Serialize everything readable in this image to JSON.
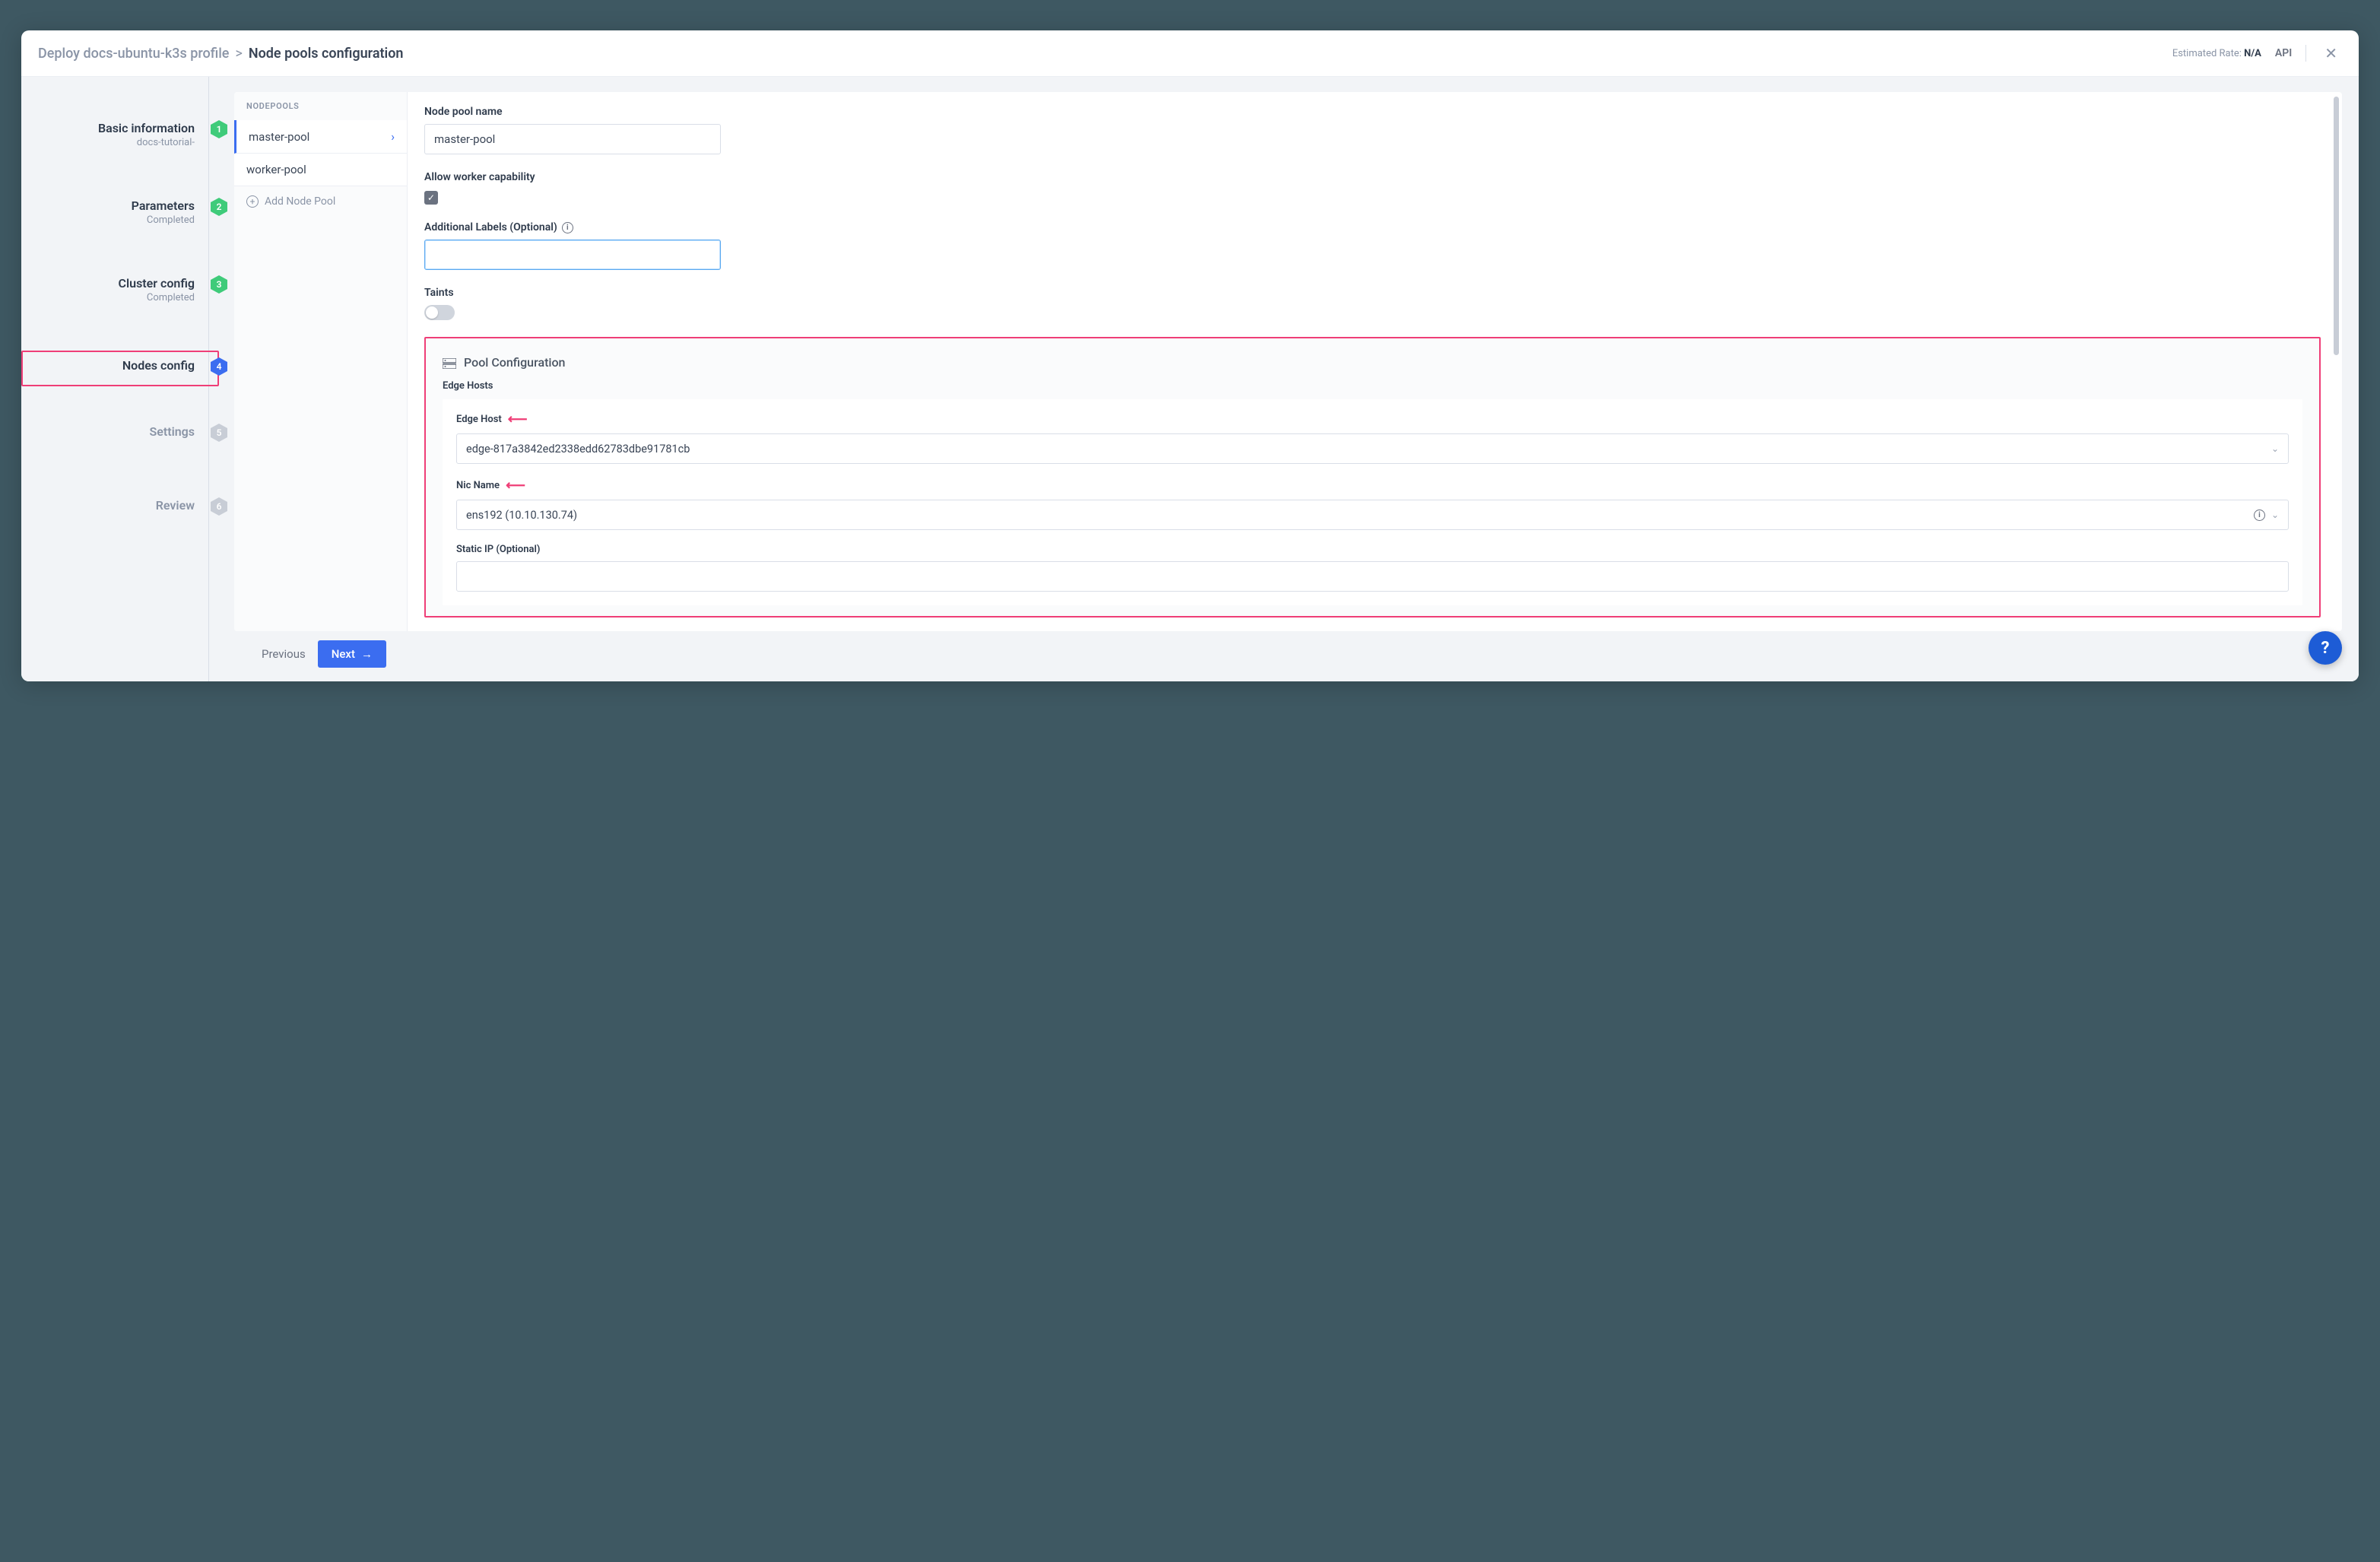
{
  "header": {
    "breadcrumb_prefix": "Deploy docs-ubuntu-k3s profile",
    "breadcrumb_sep": ">",
    "breadcrumb_current": "Node pools configuration",
    "estimated_rate_label": "Estimated Rate:",
    "estimated_rate_value": "N/A",
    "api_label": "API"
  },
  "steps": [
    {
      "title": "Basic information",
      "sub": "docs-tutorial-",
      "num": "1",
      "state": "done"
    },
    {
      "title": "Parameters",
      "sub": "Completed",
      "num": "2",
      "state": "done"
    },
    {
      "title": "Cluster config",
      "sub": "Completed",
      "num": "3",
      "state": "done"
    },
    {
      "title": "Nodes config",
      "sub": "",
      "num": "4",
      "state": "current"
    },
    {
      "title": "Settings",
      "sub": "",
      "num": "5",
      "state": "pending"
    },
    {
      "title": "Review",
      "sub": "",
      "num": "6",
      "state": "pending"
    }
  ],
  "poolcol": {
    "header": "NODEPOOLS",
    "items": [
      "master-pool",
      "worker-pool"
    ],
    "add_label": "Add Node Pool"
  },
  "form": {
    "name_label": "Node pool name",
    "name_value": "master-pool",
    "allow_worker_label": "Allow worker capability",
    "allow_worker_checked": true,
    "addl_labels_label": "Additional Labels (Optional)",
    "addl_labels_value": "",
    "taints_label": "Taints",
    "taints_on": false
  },
  "poolcfg": {
    "title": "Pool Configuration",
    "edge_hosts_label": "Edge Hosts",
    "edge_host_label": "Edge Host",
    "edge_host_value": "edge-817a3842ed2338edd62783dbe91781cb",
    "nic_label": "Nic Name",
    "nic_value": "ens192 (10.10.130.74)",
    "static_ip_label": "Static IP (Optional)",
    "static_ip_value": ""
  },
  "footer": {
    "prev": "Previous",
    "next": "Next"
  },
  "colors": {
    "accent": "#3b6df0",
    "done": "#3fcb7a",
    "pending": "#c8cdd6",
    "highlight": "#ef3e77"
  }
}
